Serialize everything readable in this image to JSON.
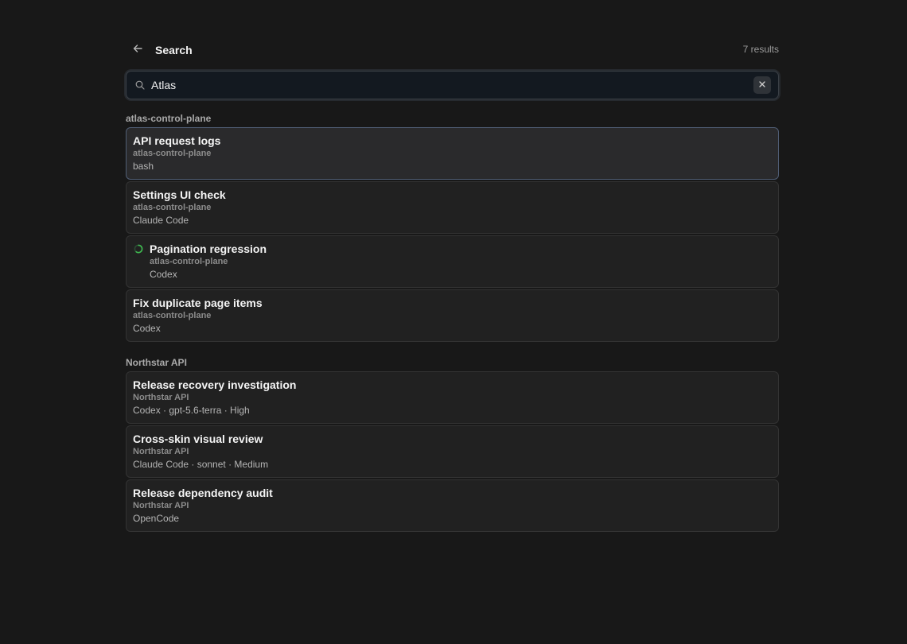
{
  "header": {
    "title": "Search",
    "result_count": "7 results"
  },
  "search": {
    "value": "Atlas",
    "placeholder": ""
  },
  "groups": [
    {
      "label": "atlas-control-plane",
      "items": [
        {
          "title": "API request logs",
          "project": "atlas-control-plane",
          "meta": "bash",
          "selected": true
        },
        {
          "title": "Settings UI check",
          "project": "atlas-control-plane",
          "meta": "Claude Code"
        },
        {
          "title": "Pagination regression",
          "project": "atlas-control-plane",
          "meta": "Codex",
          "status": "running"
        },
        {
          "title": "Fix duplicate page items",
          "project": "atlas-control-plane",
          "meta": "Codex"
        }
      ]
    },
    {
      "label": "Northstar API",
      "items": [
        {
          "title": "Release recovery investigation",
          "project": "Northstar API",
          "meta": "Codex · gpt-5.6-terra · High"
        },
        {
          "title": "Cross-skin visual review",
          "project": "Northstar API",
          "meta": "Claude Code · sonnet · Medium"
        },
        {
          "title": "Release dependency audit",
          "project": "Northstar API",
          "meta": "OpenCode"
        }
      ]
    }
  ],
  "icons": {
    "back": "arrow-left-icon",
    "search": "search-icon",
    "clear": "close-icon",
    "running": "spinner-icon"
  },
  "colors": {
    "background": "#181818",
    "card": "#212121",
    "selected_border": "#4f5d74",
    "spinner": "#3fb950"
  }
}
